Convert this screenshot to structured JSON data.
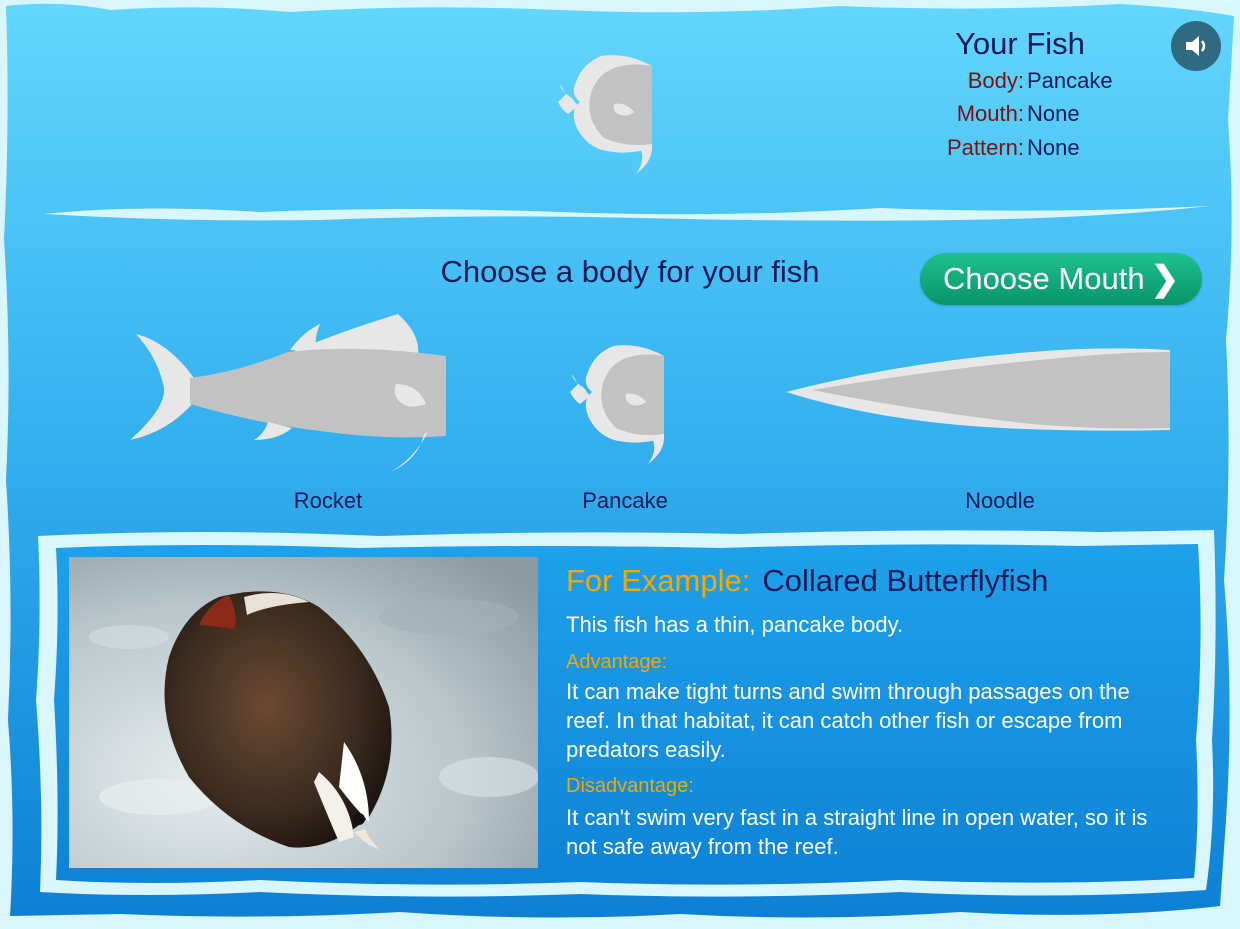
{
  "summary": {
    "title": "Your Fish",
    "body_label": "Body:",
    "body_value": "Pancake",
    "mouth_label": "Mouth:",
    "mouth_value": "None",
    "pattern_label": "Pattern:",
    "pattern_value": "None"
  },
  "sound_icon": "speaker-icon",
  "choose": {
    "heading": "Choose a body for your fish",
    "next_button": "Choose Mouth"
  },
  "bodies": [
    {
      "label": "Rocket"
    },
    {
      "label": "Pancake"
    },
    {
      "label": "Noodle"
    }
  ],
  "example": {
    "prefix": "For Example:",
    "name": "Collared Butterflyfish",
    "description": "This fish has a thin, pancake body.",
    "advantage_heading": "Advantage:",
    "advantage_text": "It can make tight turns and swim through passages on the reef. In that habitat, it can catch other fish or escape from predators easily.",
    "disadvantage_heading": "Disadvantage:",
    "disadvantage_text": "It can't swim very fast in a straight line in open water, so it is not safe away from the reef."
  },
  "colors": {
    "water_top": "#63d6fd",
    "water_bottom": "#0d80d4",
    "foam": "#d8f6fb",
    "fish_body": "#c2c2c2",
    "fish_fin": "#e7e7e7",
    "heading_navy": "#0b1a55",
    "label_red": "#7a1212",
    "example_orange": "#f6a700",
    "button_green": "#12ad7d"
  }
}
